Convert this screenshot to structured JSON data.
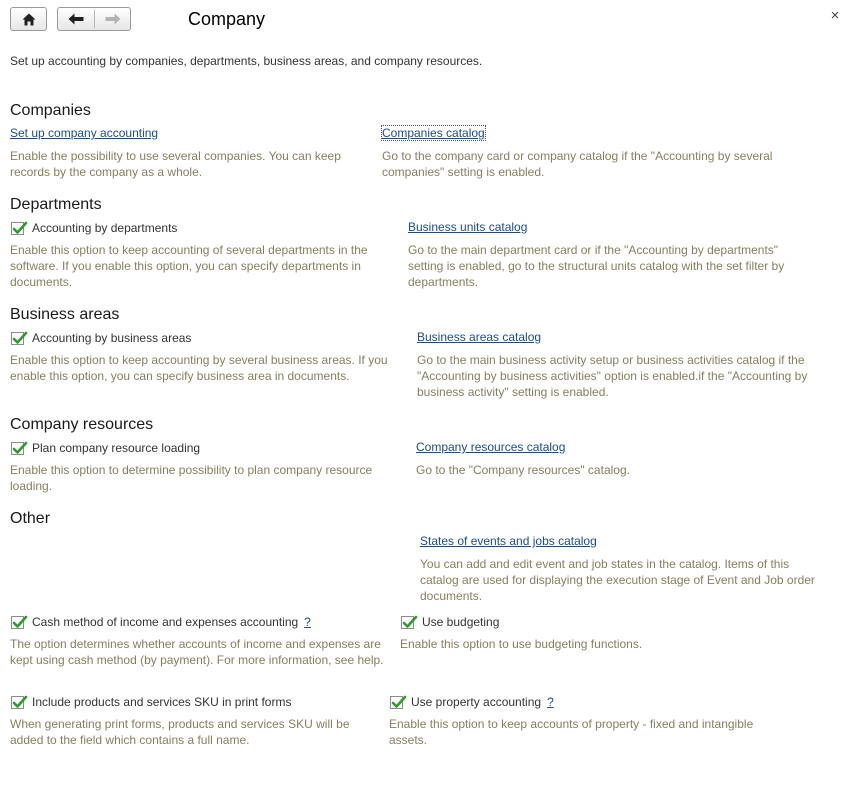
{
  "window": {
    "title": "Company",
    "close_glyph": "×"
  },
  "intro": "Set up accounting by companies, departments, business areas, and company resources.",
  "sections": {
    "companies": {
      "heading": "Companies",
      "setup_link": "Set up company accounting",
      "setup_desc": "Enable the possibility to use several companies. You can keep records by the company as a whole.",
      "catalog_link": "Companies catalog",
      "catalog_desc": "Go to the company card or company catalog if the \"Accounting by several companies\" setting is enabled."
    },
    "departments": {
      "heading": "Departments",
      "checkbox_label": "Accounting by departments",
      "checkbox_checked": true,
      "checkbox_desc": "Enable this option to keep accounting of several departments in the software. If you enable this option, you can specify departments in documents.",
      "catalog_link": "Business units catalog",
      "catalog_desc": "Go to the main department card or if the \"Accounting by departments\" setting is enabled, go to the structural units catalog with the set filter by departments."
    },
    "business_areas": {
      "heading": "Business areas",
      "checkbox_label": "Accounting by business areas",
      "checkbox_checked": true,
      "checkbox_desc": "Enable this option to keep accounting by several business areas. If you enable this option, you can specify business area in documents.",
      "catalog_link": "Business areas catalog",
      "catalog_desc": "Go to the main business activity setup or business activities catalog if the \"Accounting by business activities\" option is enabled.if the \"Accounting by business activity\" setting is enabled."
    },
    "company_resources": {
      "heading": "Company resources",
      "checkbox_label": "Plan company resource loading",
      "checkbox_checked": true,
      "checkbox_desc": "Enable this option to determine possibility to plan company resource loading.",
      "catalog_link": "Company resources catalog",
      "catalog_desc": "Go to the \"Company resources\" catalog."
    },
    "other": {
      "heading": "Other",
      "states_link": "States of events and jobs catalog",
      "states_desc": "You can add and edit event and job states in the catalog. Items of this catalog are used for displaying the execution stage of Event and Job order documents.",
      "cash_label": "Cash method of income and expenses accounting",
      "cash_checked": true,
      "cash_help": "?",
      "cash_desc": "The option determines whether accounts of income and expenses are kept using cash method (by payment). For more information, see help.",
      "budget_label": "Use budgeting",
      "budget_checked": true,
      "budget_desc": "Enable this option to use budgeting functions.",
      "sku_label": "Include products and services SKU in print forms",
      "sku_checked": true,
      "sku_desc": "When generating print forms, products and services SKU will be added to the field which contains a full name.",
      "property_label": "Use property accounting",
      "property_checked": true,
      "property_help": "?",
      "property_desc": "Enable this option to keep accounts of property - fixed and intangible assets."
    }
  },
  "colors": {
    "link": "#1a4d8f",
    "description": "#857f5f",
    "check": "#2e9a2e"
  },
  "icons": {
    "home": "home-icon",
    "back": "arrow-left-icon",
    "forward": "arrow-right-icon",
    "check": "checkmark-icon"
  }
}
